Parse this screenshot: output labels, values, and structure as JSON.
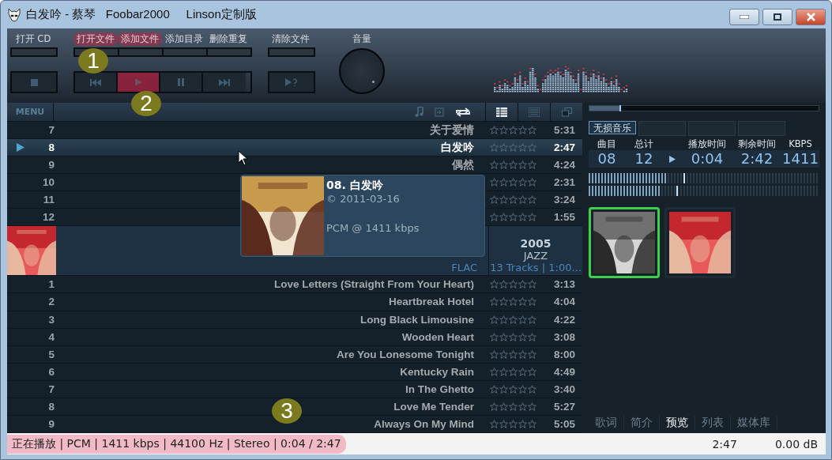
{
  "window": {
    "title": "白发吟 - 蔡琴   Foobar2000     Linson定制版"
  },
  "toolbar": {
    "groups": [
      {
        "labels": [
          {
            "text": "打开 CD",
            "highlighted": false
          }
        ],
        "buttons": [
          {
            "kind": "stop",
            "highlighted": false
          }
        ]
      },
      {
        "labels": [
          {
            "text": "打开文件",
            "highlighted": true
          },
          {
            "text": "添加文件",
            "highlighted": true
          },
          {
            "text": "添加目录",
            "highlighted": false
          },
          {
            "text": "删除重复",
            "highlighted": false
          }
        ],
        "buttons": [
          {
            "kind": "prev",
            "highlighted": false
          },
          {
            "kind": "play",
            "highlighted": true
          },
          {
            "kind": "pause",
            "highlighted": false
          },
          {
            "kind": "next",
            "highlighted": false
          }
        ]
      },
      {
        "labels": [
          {
            "text": "清除文件",
            "highlighted": false
          }
        ],
        "buttons": [
          {
            "kind": "random",
            "highlighted": false
          }
        ]
      }
    ],
    "volume_label": "音量"
  },
  "annotations": [
    {
      "label": "1"
    },
    {
      "label": "2"
    },
    {
      "label": "3"
    }
  ],
  "playlist": {
    "menu": "MENU",
    "sections": [
      {
        "kind": "tracks",
        "rows": [
          {
            "number": "7",
            "title": "关于爱情",
            "time": "5:31",
            "stars": 0,
            "playing": false
          },
          {
            "number": "8",
            "title": "白发吟",
            "time": "2:47",
            "stars": 0,
            "playing": true
          },
          {
            "number": "9",
            "title": "偶然",
            "time": "4:24",
            "stars": 0,
            "playing": false
          },
          {
            "number": "10",
            "time": "2:31",
            "stars": 0,
            "playing": false
          },
          {
            "number": "11",
            "time": "3:24",
            "stars": 0,
            "playing": false
          },
          {
            "number": "12",
            "time": "1:55",
            "stars": 0,
            "playing": false
          }
        ]
      },
      {
        "kind": "album",
        "cover": {
          "kind": "picture"
        },
        "year": "2005",
        "genre": "JAZZ",
        "codec": "FLAC",
        "summary": "13 Tracks | 1:00..."
      },
      {
        "kind": "tracks",
        "rows": [
          {
            "number": "1",
            "title": "Love Letters (Straight From Your Heart)",
            "time": "3:13",
            "stars": 0,
            "playing": false
          },
          {
            "number": "2",
            "title": "Heartbreak Hotel",
            "time": "4:04",
            "stars": 0,
            "playing": false
          },
          {
            "number": "3",
            "title": "Long Black Limousine",
            "time": "4:22",
            "stars": 0,
            "playing": false
          },
          {
            "number": "4",
            "title": "Wooden Heart",
            "time": "3:08",
            "stars": 0,
            "playing": false
          },
          {
            "number": "5",
            "title": "Are You Lonesome Tonight",
            "time": "8:00",
            "stars": 0,
            "playing": false
          },
          {
            "number": "6",
            "title": "Kentucky Rain",
            "time": "4:49",
            "stars": 0,
            "playing": false
          },
          {
            "number": "7",
            "title": "In The Ghetto",
            "time": "3:40",
            "stars": 0,
            "playing": false
          },
          {
            "number": "8",
            "title": "Love Me Tender",
            "time": "5:27",
            "stars": 0,
            "playing": false
          },
          {
            "number": "9",
            "title": "Always On My Mind",
            "time": "5:05",
            "stars": 0,
            "playing": false
          }
        ]
      }
    ]
  },
  "tooltip": {
    "cover": {
      "kind": "picture"
    },
    "title": "08. 白发吟",
    "date": "© 2011-03-16",
    "format": "PCM @ 1411 kbps"
  },
  "right_panel": {
    "seek": {
      "level": 0.13
    },
    "tabs": [
      {
        "label": "无损音乐",
        "selected": true
      }
    ],
    "info": [
      {
        "label": "曲目",
        "value": "08"
      },
      {
        "label": "总计",
        "value": "12"
      },
      {
        "label": "播放时间",
        "value": "0:04"
      },
      {
        "label": "剩余时间",
        "value": "2:42"
      },
      {
        "label": "KBPS",
        "value": "1411"
      }
    ],
    "meters": [
      {
        "level": 0.34
      },
      {
        "level": 0.31
      }
    ],
    "covers": [
      {
        "kind": "picture",
        "selected": true
      },
      {
        "kind": "picture",
        "selected": false
      }
    ],
    "bottom_tabs": [
      {
        "label": "歌词",
        "selected": false
      },
      {
        "label": "简介",
        "selected": false
      },
      {
        "label": "预览",
        "selected": true
      },
      {
        "label": "列表",
        "selected": false
      },
      {
        "label": "媒体库",
        "selected": false
      }
    ]
  },
  "status_bar": {
    "text": "正在播放 | PCM | 1411 kbps | 44100 Hz | Stereo | 0:04 / 2:47",
    "highlighted": true,
    "time": "2:47",
    "gain": "0.00 dB"
  }
}
